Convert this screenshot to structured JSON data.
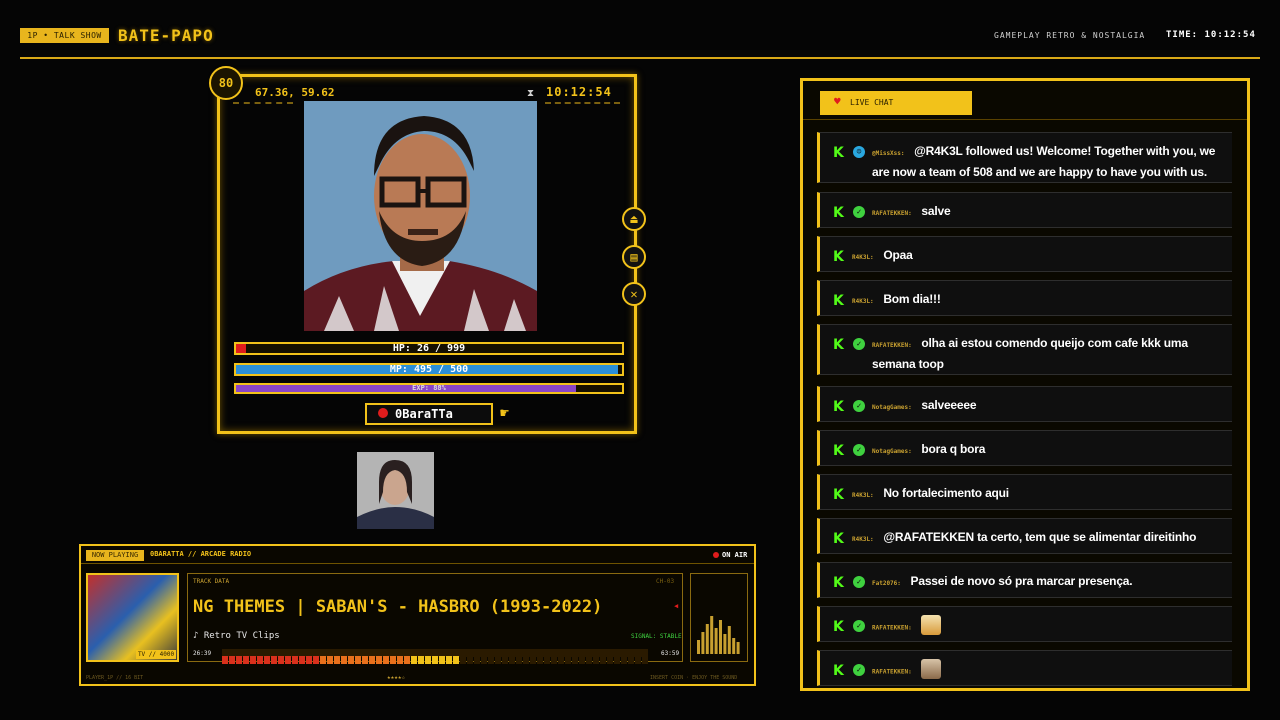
{
  "header": {
    "tag": "1P • TALK SHOW",
    "brand": "BATE-PAPO",
    "subtitle": "GAMEPLAY RETRO & NOSTALGIA",
    "time_label": "TIME: 10:12:54"
  },
  "webcam": {
    "level": "80",
    "coords": "67.36, 59.62",
    "time": "10:12:54",
    "hp": {
      "label": "HP: 26 / 999",
      "value": 26,
      "max": 999
    },
    "mp": {
      "label": "MP: 495 / 500",
      "value": 495,
      "max": 500
    },
    "exp": {
      "label": "EXP: 88%",
      "percent": 88
    },
    "username": "0BaraTTa"
  },
  "now_playing": {
    "badge": "NOW PLAYING",
    "title": "0BARATTA // ARCADE RADIO",
    "on_air": "ON AIR",
    "album_tag": "TV // 4000",
    "track_data_label": "TRACK DATA",
    "channel": "CH-03",
    "marquee": "NG THEMES | SABAN'S - HASBRO (1993-2022)",
    "source": "♪ Retro TV Clips",
    "signal": "SIGNAL: STABLE",
    "time_start": "26:39",
    "time_end": "63:59",
    "progress": 0.55,
    "footer_left": "PLAYER_1P // 16 BIT",
    "footer_center": "★★★★☆",
    "footer_right": "INSERT COIN · ENJOY THE SOUND"
  },
  "chat": {
    "tab_label": "LIVE CHAT",
    "messages": [
      {
        "user": "@MissXss:",
        "text": "@R4K3L followed us! Welcome! Together with you, we are now a team of 508 and we are happy to have you with us.",
        "badge": "bot"
      },
      {
        "user": "RAFATEKKEN:",
        "text": "salve",
        "badge": "verified"
      },
      {
        "user": "R4K3L:",
        "text": "Opaa",
        "badge": ""
      },
      {
        "user": "R4K3L:",
        "text": "Bom dia!!!",
        "badge": ""
      },
      {
        "user": "RAFATEKKEN:",
        "text": "olha ai estou comendo queijo com cafe kkk uma semana toop",
        "badge": "verified"
      },
      {
        "user": "NotagGames:",
        "text": "salveeeee",
        "badge": "verified"
      },
      {
        "user": "NotagGames:",
        "text": "bora q bora",
        "badge": "verified"
      },
      {
        "user": "R4K3L:",
        "text": "No fortalecimento aqui",
        "badge": ""
      },
      {
        "user": "R4K3L:",
        "text": "@RAFATEKKEN ta certo, tem que se alimentar direitinho",
        "badge": ""
      },
      {
        "user": "Fat2076:",
        "text": "Passei de novo só pra marcar presença.",
        "badge": "verified"
      },
      {
        "user": "RAFATEKKEN:",
        "text": "",
        "badge": "verified",
        "emote": "pog-emote"
      },
      {
        "user": "RAFATEKKEN:",
        "text": "",
        "badge": "verified",
        "emote": "cat-emote"
      }
    ]
  },
  "colors": {
    "accent": "#f2c21a",
    "kick_green": "#53fc18",
    "hp_red": "#e01c1c",
    "mp_blue": "#2b8fd8",
    "exp_purple": "#8a45c8"
  }
}
